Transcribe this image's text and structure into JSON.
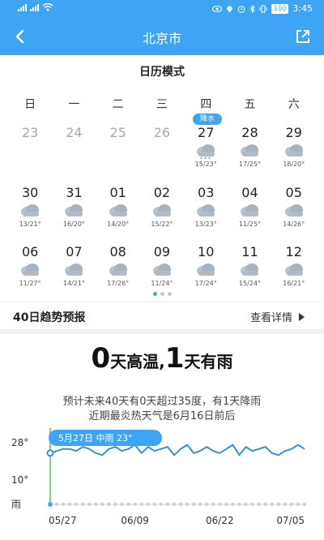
{
  "status_bar": {
    "time": "3:45",
    "battery": "100"
  },
  "header": {
    "title": "北京市"
  },
  "calendar": {
    "title": "日历模式",
    "weekdays": [
      "日",
      "一",
      "二",
      "三",
      "四",
      "五",
      "六"
    ],
    "rain_badge": "降水",
    "rows": [
      [
        {
          "day": "23",
          "temp": "",
          "past": true,
          "icon": ""
        },
        {
          "day": "24",
          "temp": "",
          "past": true,
          "icon": ""
        },
        {
          "day": "25",
          "temp": "",
          "past": true,
          "icon": ""
        },
        {
          "day": "26",
          "temp": "",
          "past": true,
          "icon": ""
        },
        {
          "day": "27",
          "temp": "15/23°",
          "past": false,
          "icon": "rain-cloud-icon"
        },
        {
          "day": "28",
          "temp": "17/25°",
          "past": false,
          "icon": "cloud-icon"
        },
        {
          "day": "29",
          "temp": "18/20°",
          "past": false,
          "icon": "cloud-icon"
        }
      ],
      [
        {
          "day": "30",
          "temp": "13/21°",
          "past": false,
          "icon": "cloud-icon"
        },
        {
          "day": "31",
          "temp": "16/20°",
          "past": false,
          "icon": "cloud-icon"
        },
        {
          "day": "01",
          "temp": "14/20°",
          "past": false,
          "icon": "cloud-icon"
        },
        {
          "day": "02",
          "temp": "15/22°",
          "past": false,
          "icon": "cloud-icon"
        },
        {
          "day": "03",
          "temp": "13/23°",
          "past": false,
          "icon": "cloud-icon"
        },
        {
          "day": "04",
          "temp": "11/25°",
          "past": false,
          "icon": "cloud-icon"
        },
        {
          "day": "05",
          "temp": "14/26°",
          "past": false,
          "icon": "cloud-icon"
        }
      ],
      [
        {
          "day": "06",
          "temp": "11/27°",
          "past": false,
          "icon": "cloud-icon"
        },
        {
          "day": "07",
          "temp": "14/21°",
          "past": false,
          "icon": "cloud-icon"
        },
        {
          "day": "08",
          "temp": "17/26°",
          "past": false,
          "icon": "cloud-icon"
        },
        {
          "day": "09",
          "temp": "11/24°",
          "past": false,
          "icon": "cloud-icon"
        },
        {
          "day": "10",
          "temp": "17/24°",
          "past": false,
          "icon": "cloud-icon"
        },
        {
          "day": "11",
          "temp": "15/24°",
          "past": false,
          "icon": "cloud-icon"
        },
        {
          "day": "12",
          "temp": "16/21°",
          "past": false,
          "icon": "cloud-icon"
        }
      ]
    ]
  },
  "trend": {
    "title": "40日趋势预报",
    "link_label": "查看详情",
    "headline": {
      "hot_days": "0",
      "hot_label": "天高温,",
      "rain_days": "1",
      "rain_label": "天有雨"
    },
    "desc_line1": "预计未来40天有0天超过35度，有1天降雨",
    "desc_line2": "近期最炎热天气是6月16日前后"
  },
  "chart_data": {
    "type": "line",
    "y_tick_labels": [
      "28°",
      "10°",
      "雨"
    ],
    "x_tick_labels": [
      "05/27",
      "06/09",
      "06/22",
      "07/05"
    ],
    "tooltip": "5月27日 中雨 23°",
    "ylim": [
      10,
      28
    ],
    "series": [
      {
        "values": [
          23,
          24,
          25,
          25,
          24,
          26,
          25,
          23,
          22,
          25,
          26,
          24,
          25,
          27,
          23,
          26,
          24,
          25,
          26,
          22,
          25,
          27,
          23,
          24,
          26,
          24,
          23,
          25,
          27,
          22,
          26,
          24,
          25,
          26,
          23,
          22,
          24,
          25,
          27,
          25
        ]
      }
    ],
    "rain_days": [
      0
    ]
  },
  "colors": {
    "accent": "#3fa4f3",
    "line": "#3a8fd6",
    "muted": "#a8a8a8"
  }
}
